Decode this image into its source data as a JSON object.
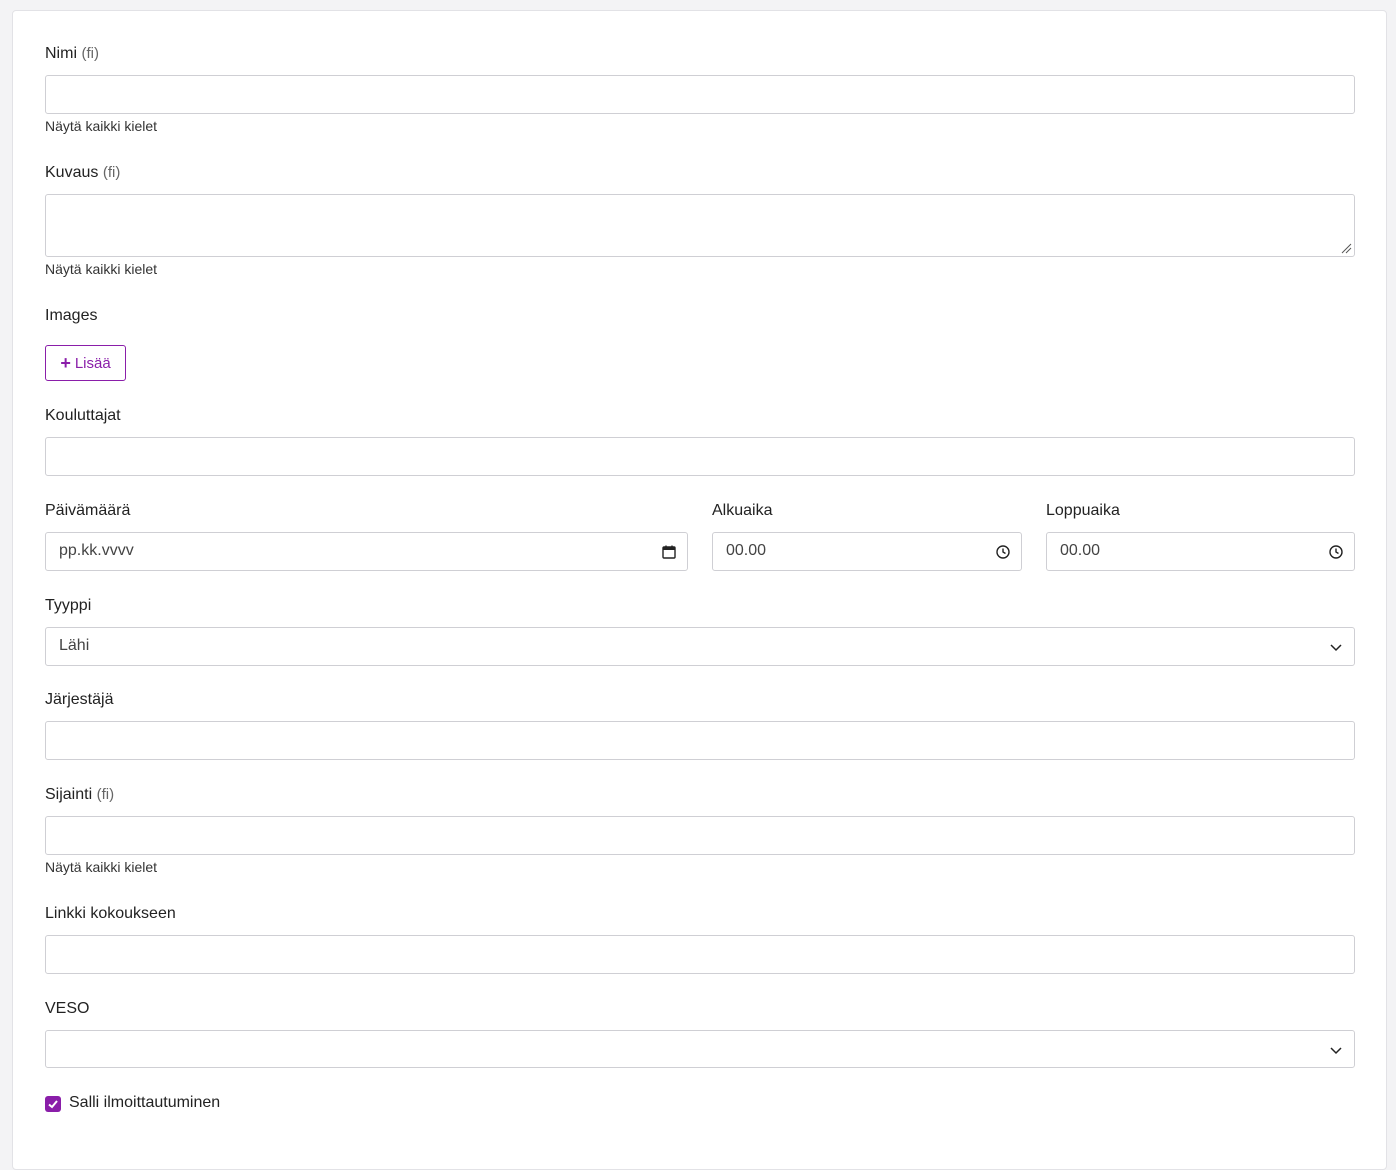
{
  "form": {
    "name": {
      "label": "Nimi",
      "lang": "(fi)",
      "value": "",
      "hint": "Näytä kaikki kielet"
    },
    "description": {
      "label": "Kuvaus",
      "lang": "(fi)",
      "value": "",
      "hint": "Näytä kaikki kielet"
    },
    "images": {
      "label": "Images",
      "add_label": "Lisää"
    },
    "trainers": {
      "label": "Kouluttajat",
      "value": ""
    },
    "date": {
      "label": "Päivämäärä",
      "placeholder": "pp.kk.vvvv",
      "icon": "calendar-icon"
    },
    "start_time": {
      "label": "Alkuaika",
      "placeholder": "00.00",
      "icon": "clock-icon"
    },
    "end_time": {
      "label": "Loppuaika",
      "placeholder": "00.00",
      "icon": "clock-icon"
    },
    "type": {
      "label": "Tyyppi",
      "selected": "Lähi"
    },
    "organizer": {
      "label": "Järjestäjä",
      "value": ""
    },
    "location": {
      "label": "Sijainti",
      "lang": "(fi)",
      "value": "",
      "hint": "Näytä kaikki kielet"
    },
    "meeting_link": {
      "label": "Linkki kokoukseen",
      "value": ""
    },
    "veso": {
      "label": "VESO",
      "selected": ""
    },
    "allow_registration": {
      "label": "Salli ilmoittautuminen",
      "checked": true
    }
  },
  "colors": {
    "accent": "#8a1ea9",
    "border": "#cfcfd4"
  }
}
